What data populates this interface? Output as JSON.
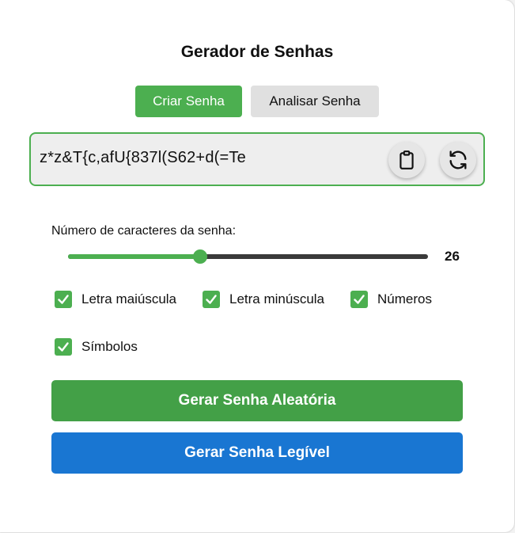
{
  "app": {
    "title": "Gerador de Senhas"
  },
  "tabs": {
    "create_label": "Criar Senha",
    "analyze_label": "Analisar Senha",
    "active": "create"
  },
  "password": {
    "value": "z*z&T{c,afU{837l(S62+d(=Te",
    "copy_icon": "clipboard-icon",
    "refresh_icon": "refresh-icon"
  },
  "length": {
    "label": "Número de caracteres da senha:",
    "value": "26",
    "min": 4,
    "max": 64,
    "current": 26
  },
  "options": {
    "uppercase": {
      "label": "Letra maiúscula",
      "checked": true
    },
    "lowercase": {
      "label": "Letra minúscula",
      "checked": true
    },
    "numbers": {
      "label": "Números",
      "checked": true
    },
    "symbols": {
      "label": "Símbolos",
      "checked": true
    }
  },
  "actions": {
    "random_label": "Gerar Senha Aleatória",
    "readable_label": "Gerar Senha Legível"
  },
  "colors": {
    "accent_green": "#4caf50",
    "button_green": "#43a047",
    "button_blue": "#1976d2",
    "tab_inactive": "#e0e0e0",
    "slider_track": "#3a3a3a"
  }
}
